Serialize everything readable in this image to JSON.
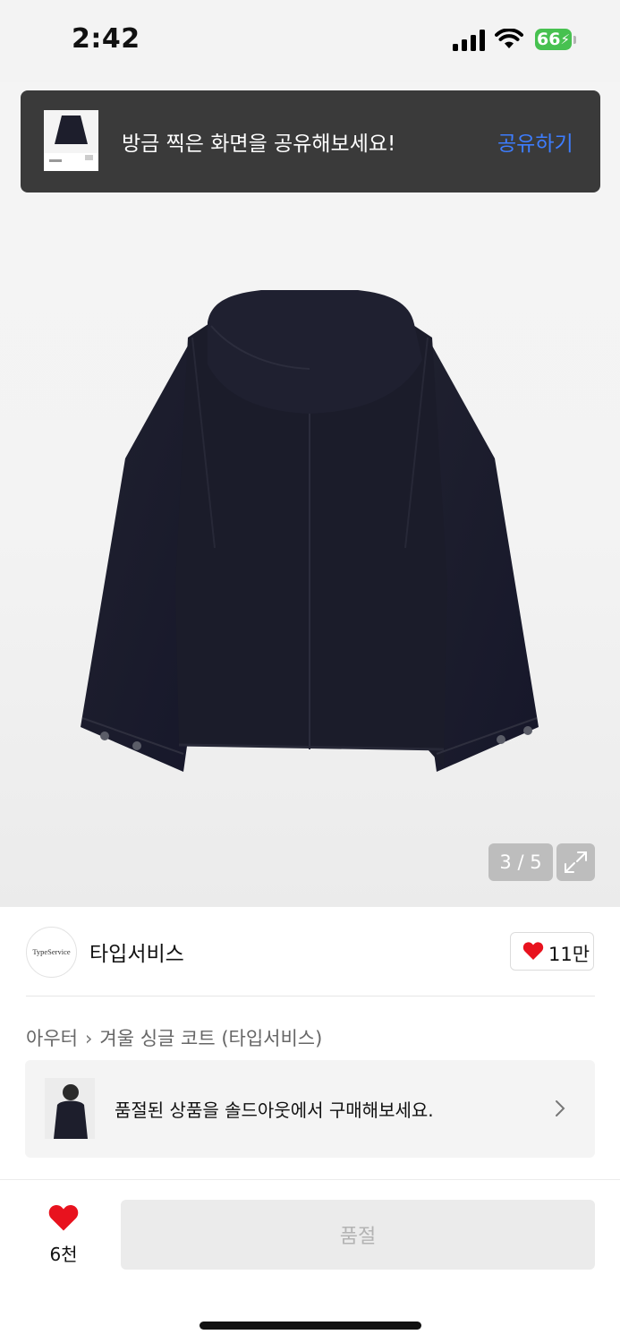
{
  "status_bar": {
    "time": "2:42",
    "battery": "66"
  },
  "toast": {
    "message": "방금 찍은 화면을 공유해보세요!",
    "action": "공유하기"
  },
  "gallery": {
    "counter": "3 / 5",
    "current": 3,
    "total": 5
  },
  "brand": {
    "logo_text": "TypeService",
    "name": "타입서비스",
    "likes": "11만"
  },
  "breadcrumb": {
    "category": "아우터",
    "product": "겨울 싱글 코트 (타입서비스)"
  },
  "soldout_banner": {
    "message": "품절된 상품을 솔드아웃에서 구매해보세요."
  },
  "bottom_bar": {
    "wish_count": "6천",
    "buy_label": "품절"
  },
  "colors": {
    "accent_red": "#e8121e",
    "link_blue": "#3d7dff",
    "jacket_navy": "#1b1c2a",
    "toast_bg": "#3a3a3a"
  }
}
